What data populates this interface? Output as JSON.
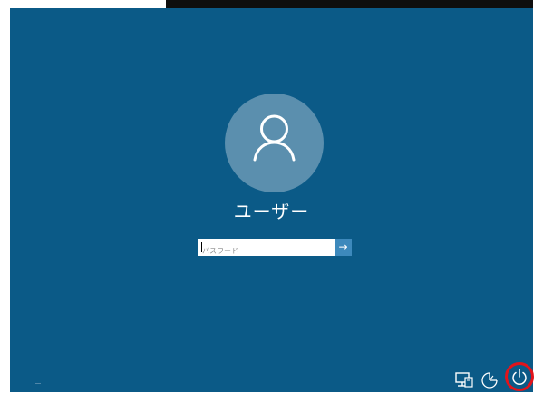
{
  "user": {
    "name": "ユーザー"
  },
  "password": {
    "placeholder": "パスワード",
    "value": ""
  },
  "submit": {
    "arrow": "→"
  },
  "icons": {
    "avatar": "user-avatar-icon",
    "network": "network-icon",
    "ease_of_access": "ease-of-access-icon",
    "power": "power-icon"
  },
  "colors": {
    "background": "#0b5a87",
    "avatar": "#5b8fae",
    "submit_button": "#3d89bc",
    "highlight": "#e2141b"
  }
}
